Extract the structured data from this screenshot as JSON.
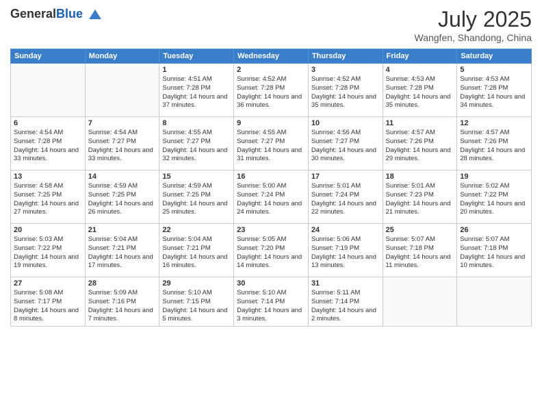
{
  "header": {
    "logo_general": "General",
    "logo_blue": "Blue",
    "month_title": "July 2025",
    "subtitle": "Wangfen, Shandong, China"
  },
  "calendar": {
    "days_of_week": [
      "Sunday",
      "Monday",
      "Tuesday",
      "Wednesday",
      "Thursday",
      "Friday",
      "Saturday"
    ],
    "weeks": [
      [
        {
          "day": "",
          "info": ""
        },
        {
          "day": "",
          "info": ""
        },
        {
          "day": "1",
          "info": "Sunrise: 4:51 AM\nSunset: 7:28 PM\nDaylight: 14 hours and 37 minutes."
        },
        {
          "day": "2",
          "info": "Sunrise: 4:52 AM\nSunset: 7:28 PM\nDaylight: 14 hours and 36 minutes."
        },
        {
          "day": "3",
          "info": "Sunrise: 4:52 AM\nSunset: 7:28 PM\nDaylight: 14 hours and 35 minutes."
        },
        {
          "day": "4",
          "info": "Sunrise: 4:53 AM\nSunset: 7:28 PM\nDaylight: 14 hours and 35 minutes."
        },
        {
          "day": "5",
          "info": "Sunrise: 4:53 AM\nSunset: 7:28 PM\nDaylight: 14 hours and 34 minutes."
        }
      ],
      [
        {
          "day": "6",
          "info": "Sunrise: 4:54 AM\nSunset: 7:28 PM\nDaylight: 14 hours and 33 minutes."
        },
        {
          "day": "7",
          "info": "Sunrise: 4:54 AM\nSunset: 7:27 PM\nDaylight: 14 hours and 33 minutes."
        },
        {
          "day": "8",
          "info": "Sunrise: 4:55 AM\nSunset: 7:27 PM\nDaylight: 14 hours and 32 minutes."
        },
        {
          "day": "9",
          "info": "Sunrise: 4:55 AM\nSunset: 7:27 PM\nDaylight: 14 hours and 31 minutes."
        },
        {
          "day": "10",
          "info": "Sunrise: 4:56 AM\nSunset: 7:27 PM\nDaylight: 14 hours and 30 minutes."
        },
        {
          "day": "11",
          "info": "Sunrise: 4:57 AM\nSunset: 7:26 PM\nDaylight: 14 hours and 29 minutes."
        },
        {
          "day": "12",
          "info": "Sunrise: 4:57 AM\nSunset: 7:26 PM\nDaylight: 14 hours and 28 minutes."
        }
      ],
      [
        {
          "day": "13",
          "info": "Sunrise: 4:58 AM\nSunset: 7:25 PM\nDaylight: 14 hours and 27 minutes."
        },
        {
          "day": "14",
          "info": "Sunrise: 4:59 AM\nSunset: 7:25 PM\nDaylight: 14 hours and 26 minutes."
        },
        {
          "day": "15",
          "info": "Sunrise: 4:59 AM\nSunset: 7:25 PM\nDaylight: 14 hours and 25 minutes."
        },
        {
          "day": "16",
          "info": "Sunrise: 5:00 AM\nSunset: 7:24 PM\nDaylight: 14 hours and 24 minutes."
        },
        {
          "day": "17",
          "info": "Sunrise: 5:01 AM\nSunset: 7:24 PM\nDaylight: 14 hours and 22 minutes."
        },
        {
          "day": "18",
          "info": "Sunrise: 5:01 AM\nSunset: 7:23 PM\nDaylight: 14 hours and 21 minutes."
        },
        {
          "day": "19",
          "info": "Sunrise: 5:02 AM\nSunset: 7:22 PM\nDaylight: 14 hours and 20 minutes."
        }
      ],
      [
        {
          "day": "20",
          "info": "Sunrise: 5:03 AM\nSunset: 7:22 PM\nDaylight: 14 hours and 19 minutes."
        },
        {
          "day": "21",
          "info": "Sunrise: 5:04 AM\nSunset: 7:21 PM\nDaylight: 14 hours and 17 minutes."
        },
        {
          "day": "22",
          "info": "Sunrise: 5:04 AM\nSunset: 7:21 PM\nDaylight: 14 hours and 16 minutes."
        },
        {
          "day": "23",
          "info": "Sunrise: 5:05 AM\nSunset: 7:20 PM\nDaylight: 14 hours and 14 minutes."
        },
        {
          "day": "24",
          "info": "Sunrise: 5:06 AM\nSunset: 7:19 PM\nDaylight: 14 hours and 13 minutes."
        },
        {
          "day": "25",
          "info": "Sunrise: 5:07 AM\nSunset: 7:18 PM\nDaylight: 14 hours and 11 minutes."
        },
        {
          "day": "26",
          "info": "Sunrise: 5:07 AM\nSunset: 7:18 PM\nDaylight: 14 hours and 10 minutes."
        }
      ],
      [
        {
          "day": "27",
          "info": "Sunrise: 5:08 AM\nSunset: 7:17 PM\nDaylight: 14 hours and 8 minutes."
        },
        {
          "day": "28",
          "info": "Sunrise: 5:09 AM\nSunset: 7:16 PM\nDaylight: 14 hours and 7 minutes."
        },
        {
          "day": "29",
          "info": "Sunrise: 5:10 AM\nSunset: 7:15 PM\nDaylight: 14 hours and 5 minutes."
        },
        {
          "day": "30",
          "info": "Sunrise: 5:10 AM\nSunset: 7:14 PM\nDaylight: 14 hours and 3 minutes."
        },
        {
          "day": "31",
          "info": "Sunrise: 5:11 AM\nSunset: 7:14 PM\nDaylight: 14 hours and 2 minutes."
        },
        {
          "day": "",
          "info": ""
        },
        {
          "day": "",
          "info": ""
        }
      ]
    ]
  }
}
